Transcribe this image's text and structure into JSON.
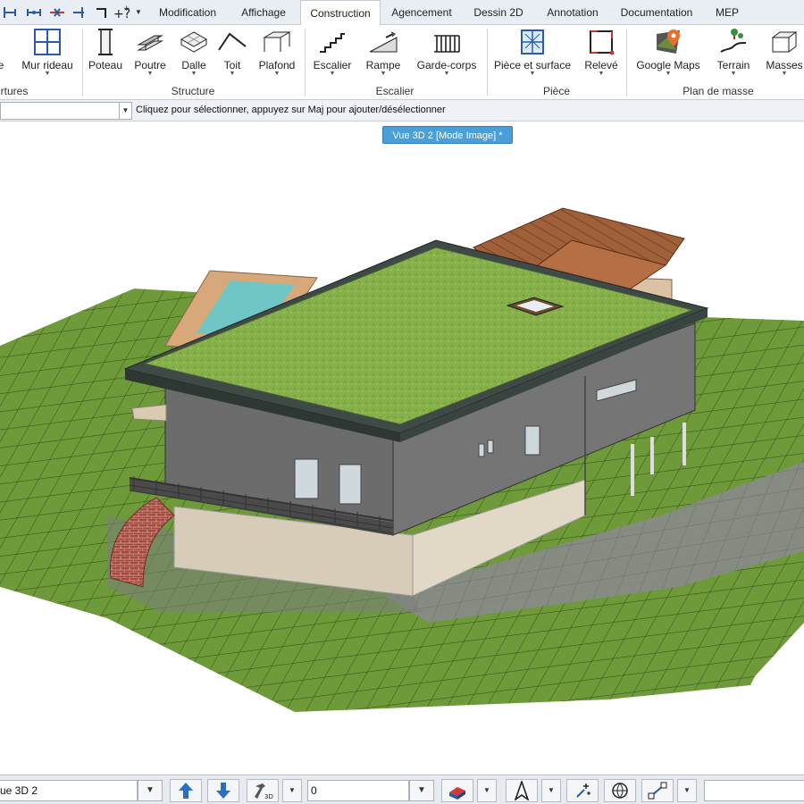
{
  "tabs": [
    {
      "label": "Modification"
    },
    {
      "label": "Affichage"
    },
    {
      "label": "Construction"
    },
    {
      "label": "Agencement"
    },
    {
      "label": "Dessin 2D"
    },
    {
      "label": "Annotation"
    },
    {
      "label": "Documentation"
    },
    {
      "label": "MEP"
    }
  ],
  "active_tab": "Construction",
  "ribbon": {
    "buttons": [
      {
        "label": "e"
      },
      {
        "label": "Mur rideau"
      },
      {
        "label": "Poteau"
      },
      {
        "label": "Poutre"
      },
      {
        "label": "Dalle"
      },
      {
        "label": "Toit"
      },
      {
        "label": "Plafond"
      },
      {
        "label": "Escalier"
      },
      {
        "label": "Rampe"
      },
      {
        "label": "Garde-corps"
      },
      {
        "label": "Pièce et surface"
      },
      {
        "label": "Relevé"
      },
      {
        "label": "Google Maps"
      },
      {
        "label": "Terrain"
      },
      {
        "label": "Masses"
      }
    ],
    "groups": [
      {
        "label": "rtures"
      },
      {
        "label": "Structure"
      },
      {
        "label": "Escalier"
      },
      {
        "label": "Pièce"
      },
      {
        "label": "Plan de masse"
      }
    ]
  },
  "command_bar": {
    "hint": "Cliquez pour sélectionner, appuyez sur Maj pour ajouter/désélectionner"
  },
  "viewport": {
    "tab_title": "Vue 3D 2 [Mode Image] *"
  },
  "statusbar": {
    "view_select": "ue 3D 2",
    "value_field": "0"
  }
}
